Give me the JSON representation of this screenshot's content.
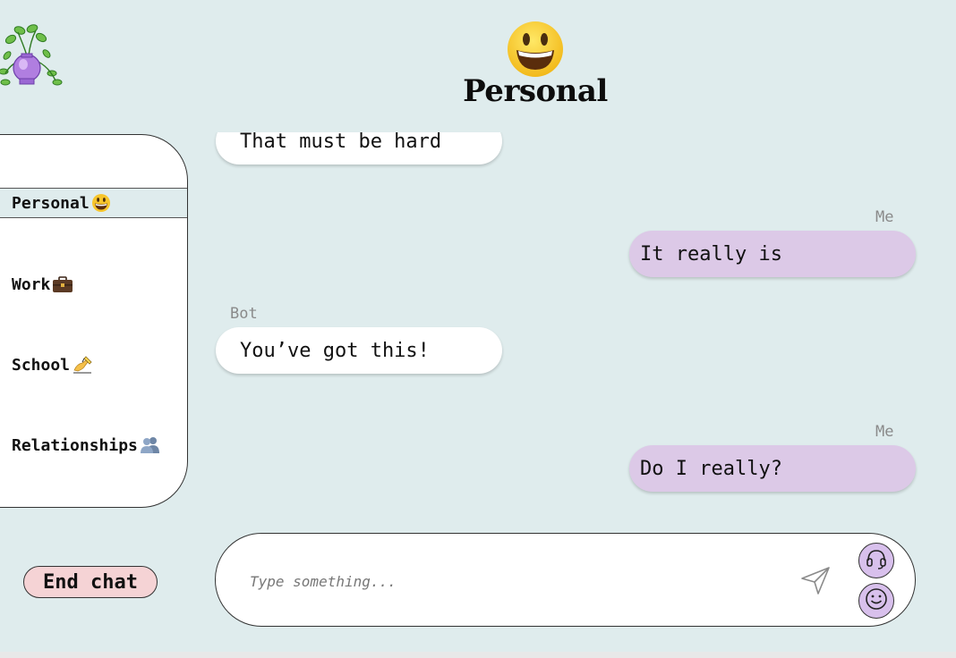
{
  "header": {
    "title": "Personal",
    "emoji_icon": "grinning-face-icon"
  },
  "logo": {
    "icon": "plant-vase-logo-icon"
  },
  "sidebar": {
    "items": [
      {
        "label": "Personal",
        "icon": "grinning-face-icon",
        "active": true
      },
      {
        "label": "Work",
        "icon": "briefcase-icon",
        "active": false
      },
      {
        "label": "School",
        "icon": "writing-hand-icon",
        "active": false
      },
      {
        "label": "Relationships",
        "icon": "busts-icon",
        "active": false
      }
    ]
  },
  "end_chat": {
    "label": "End chat"
  },
  "messages": [
    {
      "sender": "",
      "text": "That must be hard",
      "from": "bot"
    },
    {
      "sender": "Me",
      "text": "It really is",
      "from": "me"
    },
    {
      "sender": "Bot",
      "text": "You’ve got this!",
      "from": "bot"
    },
    {
      "sender": "Me",
      "text": "Do I really?",
      "from": "me"
    }
  ],
  "input": {
    "placeholder": "Type something...",
    "value": ""
  },
  "buttons": {
    "send_icon": "send-paper-plane-icon",
    "support_icon": "headset-icon",
    "emoji_icon": "smiley-icon"
  },
  "colors": {
    "background": "#dfeced",
    "me_bubble": "#dcc9e7",
    "bot_bubble": "#ffffff",
    "end_chat": "#f5d3d5",
    "round_button": "#d8c0ec"
  }
}
